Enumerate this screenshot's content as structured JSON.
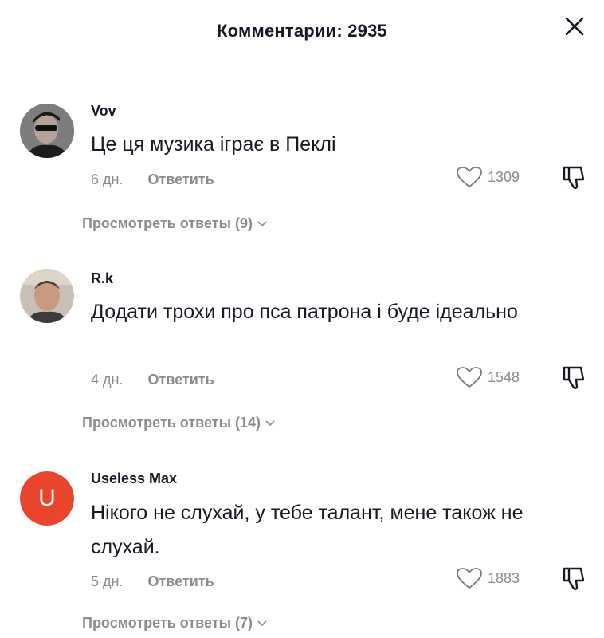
{
  "header": {
    "title": "Комментарии: 2935",
    "close_icon": "close-icon"
  },
  "comments": [
    {
      "username": "Vov",
      "avatar": "photo-avatar",
      "text": "Це ця музика іграє в Пеклі",
      "time": "6 дн.",
      "reply_label": "Ответить",
      "likes": "1309",
      "view_replies": "Просмотреть ответы (9)"
    },
    {
      "username": "R.k",
      "avatar": "photo-avatar",
      "text": "Додати трохи про пса патрона і буде ідеально",
      "time": "4 дн.",
      "reply_label": "Ответить",
      "likes": "1548",
      "view_replies": "Просмотреть ответы (14)"
    },
    {
      "username": "Useless Max",
      "avatar_letter": "U",
      "avatar_color": "#e8452c",
      "text": "Нікого не слухай, у тебе талант, мене також не слухай.",
      "time": "5 дн.",
      "reply_label": "Ответить",
      "likes": "1883",
      "view_replies": "Просмотреть ответы (7)"
    }
  ],
  "colors": {
    "primary_text": "#161823",
    "secondary_text": "#8a8b91"
  }
}
